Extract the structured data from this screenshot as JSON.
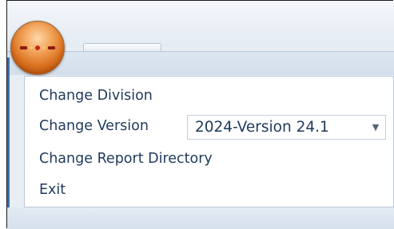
{
  "app_button": {
    "icon": "app-orb-icon"
  },
  "menu": {
    "change_division": "Change Division",
    "change_version": "Change Version",
    "change_report_directory": "Change Report Directory",
    "exit": "Exit"
  },
  "version_select": {
    "selected": "2024-Version 24.1",
    "arrow_icon": "chevron-down-icon"
  }
}
